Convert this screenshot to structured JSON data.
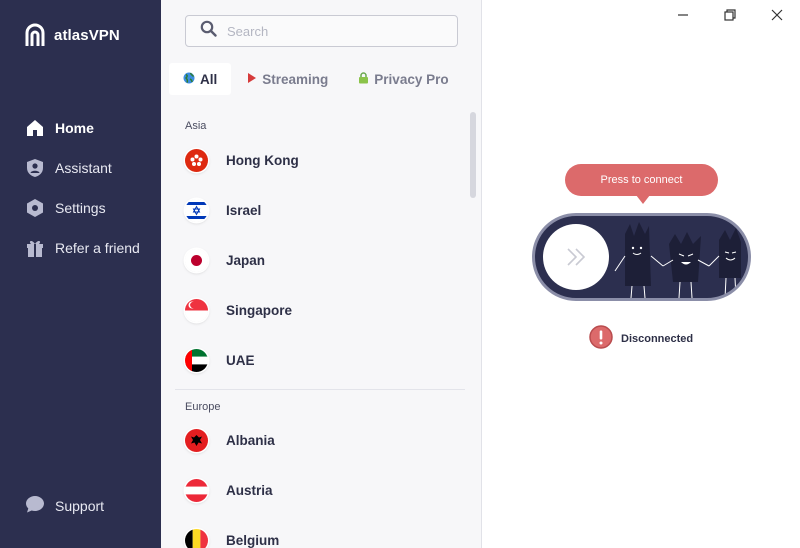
{
  "brand": {
    "name": "atlasVPN",
    "accent": "#dc6a6b",
    "sidebar_bg": "#2c2f4f"
  },
  "sidebar": {
    "items": [
      {
        "label": "Home",
        "icon": "home-icon",
        "active": true
      },
      {
        "label": "Assistant",
        "icon": "shield-user-icon",
        "active": false
      },
      {
        "label": "Settings",
        "icon": "hexagon-gear-icon",
        "active": false
      },
      {
        "label": "Refer a friend",
        "icon": "gift-icon",
        "active": false
      }
    ],
    "support_label": "Support"
  },
  "search": {
    "placeholder": "Search",
    "value": ""
  },
  "tabs": [
    {
      "label": "All",
      "icon": "globe-icon",
      "active": true
    },
    {
      "label": "Streaming",
      "icon": "play-icon",
      "active": false
    },
    {
      "label": "Privacy Pro",
      "icon": "lock-icon",
      "active": false
    }
  ],
  "regions": [
    {
      "name": "Asia",
      "countries": [
        "Hong Kong",
        "Israel",
        "Japan",
        "Singapore",
        "UAE"
      ]
    },
    {
      "name": "Europe",
      "countries": [
        "Albania",
        "Austria",
        "Belgium"
      ]
    }
  ],
  "connect": {
    "tooltip": "Press to connect",
    "status": "Disconnected",
    "status_icon": "exclamation-icon"
  },
  "window_controls": [
    "minimize-icon",
    "restore-icon",
    "close-icon"
  ]
}
